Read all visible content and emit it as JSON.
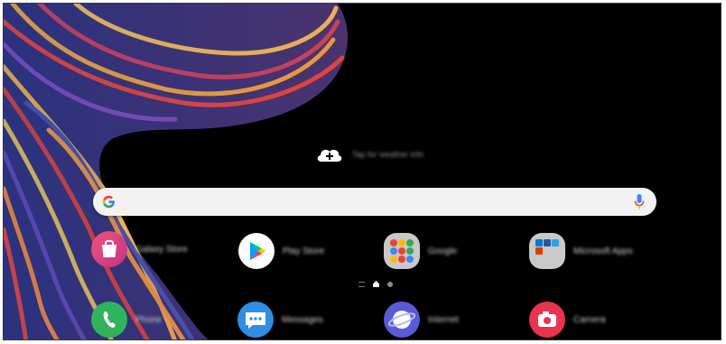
{
  "weather": {
    "label": "Tap for weather info",
    "icon": "cloud-plus-icon"
  },
  "search": {
    "logo": "google-g-icon",
    "mic": "microphone-icon"
  },
  "apps_row1": [
    {
      "label": "Galaxy Store",
      "icon": "galaxy-store-icon"
    },
    {
      "label": "Play Store",
      "icon": "play-store-icon"
    },
    {
      "label": "Google",
      "icon": "google-folder-icon"
    },
    {
      "label": "Microsoft Apps",
      "icon": "microsoft-folder-icon"
    }
  ],
  "page_indicator": {
    "pages": 2,
    "current": 1,
    "home_icon": "home-icon"
  },
  "dock": [
    {
      "label": "Phone",
      "icon": "phone-icon"
    },
    {
      "label": "Messages",
      "icon": "messages-icon"
    },
    {
      "label": "Internet",
      "icon": "internet-icon"
    },
    {
      "label": "Camera",
      "icon": "camera-icon"
    }
  ],
  "colors": {
    "background": "#000000",
    "search_bar": "#f2f2f2",
    "phone": "#2fb35c",
    "messages": "#2f8de4",
    "internet": "#5a5ad6",
    "camera": "#e8344e"
  }
}
